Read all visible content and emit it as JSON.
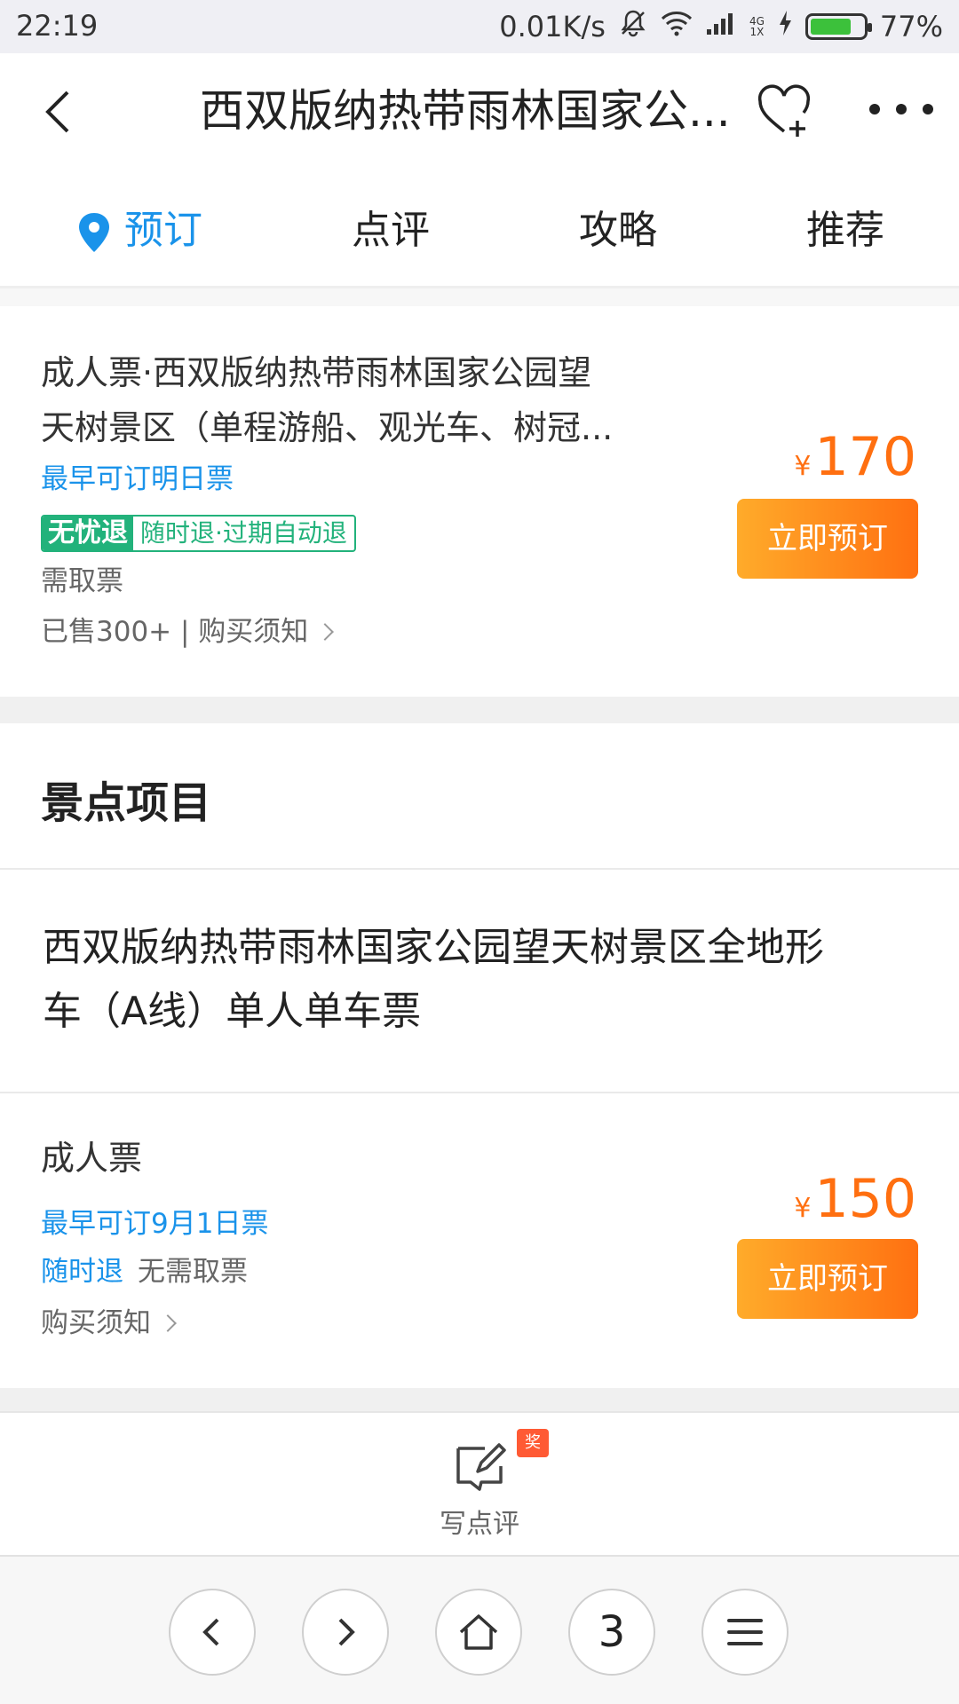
{
  "status": {
    "time": "22:19",
    "speed": "0.01K/s",
    "net_top": "4G",
    "net_bottom": "1X",
    "battery": "77%",
    "battery_level": 0.77,
    "battery_color": "#3cc13b"
  },
  "header": {
    "title": "西双版纳热带雨林国家公..."
  },
  "tabs": [
    {
      "label": "预订",
      "active": true
    },
    {
      "label": "点评"
    },
    {
      "label": "攻略"
    },
    {
      "label": "推荐"
    }
  ],
  "ticket1": {
    "title_line1": "成人票·西双版纳热带雨林国家公园望",
    "title_line2": "天树景区（单程游船、观光车、树冠...",
    "earliest": "最早可订明日票",
    "badge_main": "无忧退",
    "badge_sub": "随时退·过期自动退",
    "pickup": "需取票",
    "sold_notice": "已售300+ | 购买须知",
    "currency": "¥",
    "price": "170",
    "button": "立即预订"
  },
  "section_heading": "景点项目",
  "item": {
    "title_line1": "西双版纳热带雨林国家公园望天树景区全地形",
    "title_line2": "车（A线）单人单车票"
  },
  "ticket2": {
    "title": "成人票",
    "earliest": "最早可订9月1日票",
    "refund": "随时退",
    "pickup": "无需取票",
    "notice": "购买须知",
    "currency": "¥",
    "price": "150",
    "button": "立即预订"
  },
  "footer": {
    "award": "奖",
    "write_review": "写点评"
  },
  "browser": {
    "tab_count": "3"
  },
  "colors": {
    "accent_blue": "#1a93ea",
    "price_orange": "#ff6f10",
    "badge_green": "#22b27b"
  }
}
